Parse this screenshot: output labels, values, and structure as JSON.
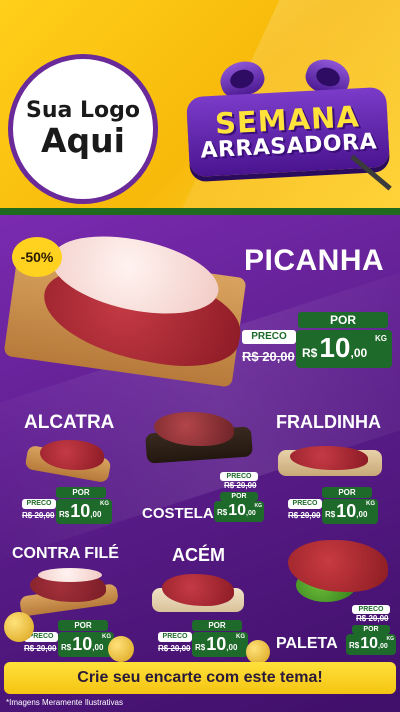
{
  "header": {
    "logo_line1": "Sua Logo",
    "logo_line2": "Aqui",
    "promo_line1": "SEMANA",
    "promo_line2": "ARRASADORA"
  },
  "featured": {
    "name": "PICANHA",
    "discount": "-50%",
    "preco_label": "PRECO",
    "por_label": "POR",
    "old_price": "R$ 20,00",
    "price_currency": "R$",
    "price_int": "10",
    "price_dec": ",00",
    "price_unit": "KG"
  },
  "products": [
    {
      "name": "ALCATRA",
      "preco_label": "PRECO",
      "por_label": "POR",
      "old_price": "R$ 20,00",
      "price_currency": "R$",
      "price_int": "10",
      "price_dec": ",00",
      "price_unit": "KG"
    },
    {
      "name": "COSTELA",
      "preco_label": "PRECO",
      "por_label": "POR",
      "old_price": "R$ 20,00",
      "price_currency": "R$",
      "price_int": "10",
      "price_dec": ",00",
      "price_unit": "KG"
    },
    {
      "name": "FRALDINHA",
      "preco_label": "PRECO",
      "por_label": "POR",
      "old_price": "R$ 20,00",
      "price_currency": "R$",
      "price_int": "10",
      "price_dec": ",00",
      "price_unit": "KG"
    },
    {
      "name": "CONTRA FILÉ",
      "preco_label": "PRECO",
      "por_label": "POR",
      "old_price": "R$ 20,00",
      "price_currency": "R$",
      "price_int": "10",
      "price_dec": ",00",
      "price_unit": "KG"
    },
    {
      "name": "ACÉM",
      "preco_label": "PRECO",
      "por_label": "POR",
      "old_price": "R$ 20,00",
      "price_currency": "R$",
      "price_int": "10",
      "price_dec": ",00",
      "price_unit": "KG"
    },
    {
      "name": "PALETA",
      "preco_label": "PRECO",
      "por_label": "POR",
      "old_price": "R$ 20,00",
      "price_currency": "R$",
      "price_int": "10",
      "price_dec": ",00",
      "price_unit": "KG"
    }
  ],
  "cta": "Crie seu encarte com este tema!",
  "disclaimer": "*Imagens Meramente Ilustrativas",
  "colors": {
    "header_yellow": "#ffcf1a",
    "background_purple": "#5c1d8c",
    "price_green": "#1e6a2a",
    "cta_yellow": "#f4c412"
  }
}
